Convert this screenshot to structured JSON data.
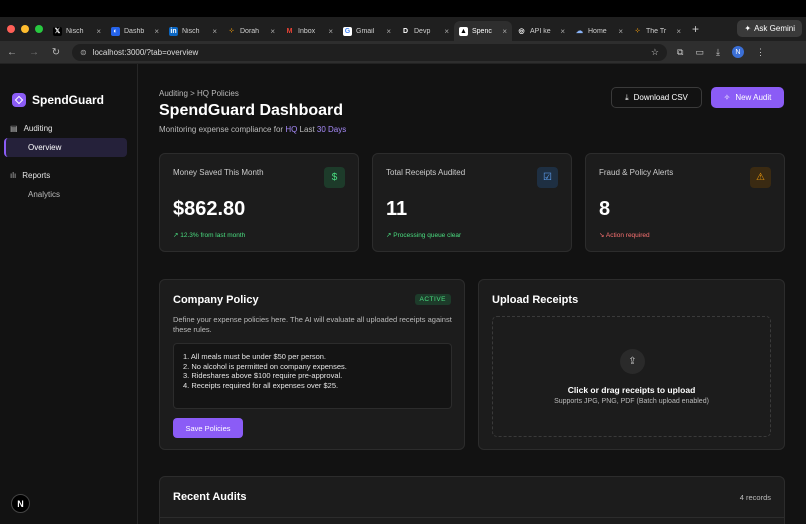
{
  "browser": {
    "tabs": [
      {
        "label": "Nisch",
        "icon": "x-logo-icon",
        "active": false
      },
      {
        "label": "Dashb",
        "icon": "globe-icon",
        "active": false
      },
      {
        "label": "Nisch",
        "icon": "linkedin-icon",
        "active": false
      },
      {
        "label": "Dorah",
        "icon": "dots-icon",
        "active": false
      },
      {
        "label": "Inbox",
        "icon": "gmail-icon",
        "active": false
      },
      {
        "label": "Gmail",
        "icon": "google-icon",
        "active": false
      },
      {
        "label": "Devp",
        "icon": "d-icon",
        "active": false
      },
      {
        "label": "Spenc",
        "icon": "triangle-icon",
        "active": true
      },
      {
        "label": "API ke",
        "icon": "openai-icon",
        "active": false
      },
      {
        "label": "Home",
        "icon": "cloud-icon",
        "active": false
      },
      {
        "label": "The Tr",
        "icon": "dots-icon",
        "active": false
      }
    ],
    "gemini_label": "Ask Gemini",
    "url": "localhost:3000/?tab=overview",
    "profile_initial": "N"
  },
  "sidebar": {
    "brand": "SpendGuard",
    "sections": [
      {
        "label": "Auditing",
        "items": [
          {
            "label": "Overview",
            "active": true
          }
        ]
      },
      {
        "label": "Reports",
        "items": [
          {
            "label": "Analytics",
            "active": false
          }
        ]
      }
    ],
    "bottom_badge": "N"
  },
  "header": {
    "breadcrumb": "Auditing > HQ Policies",
    "title": "SpendGuard Dashboard",
    "subtitle_prefix": "Monitoring expense compliance for",
    "subtitle_hq": "HQ",
    "subtitle_last": "Last",
    "subtitle_days": "30 Days",
    "download_label": "Download CSV",
    "new_audit_label": "New Audit"
  },
  "stats": [
    {
      "label": "Money Saved This Month",
      "value": "$862.80",
      "note": "12.3% from last month",
      "note_color": "#4ade80",
      "icon": "dollar-icon",
      "icon_color": "#4ade80",
      "icon_bg": "#1d3b2a"
    },
    {
      "label": "Total Receipts Audited",
      "value": "11",
      "note": "Processing queue clear",
      "note_color": "#4ade80",
      "icon": "checkbox-icon",
      "icon_color": "#60a5fa",
      "icon_bg": "#1e2f42"
    },
    {
      "label": "Fraud & Policy Alerts",
      "value": "8",
      "note": "Action required",
      "note_color": "#f87171",
      "icon": "warning-icon",
      "icon_color": "#f59e0b",
      "icon_bg": "#3a2a12"
    }
  ],
  "policy": {
    "title": "Company Policy",
    "badge": "ACTIVE",
    "description": "Define your expense policies here. The AI will evaluate all uploaded receipts against these rules.",
    "rules": [
      "1. All meals must be under $50 per person.",
      "2. No alcohol is permitted on company expenses.",
      "3. Rideshares above $100 require pre-approval.",
      "4. Receipts required for all expenses over $25."
    ],
    "save_label": "Save Policies"
  },
  "upload": {
    "title": "Upload Receipts",
    "drop_title": "Click or drag receipts to upload",
    "drop_sub": "Supports JPG, PNG, PDF (Batch upload enabled)"
  },
  "recent": {
    "title": "Recent Audits",
    "count": "4 records"
  }
}
